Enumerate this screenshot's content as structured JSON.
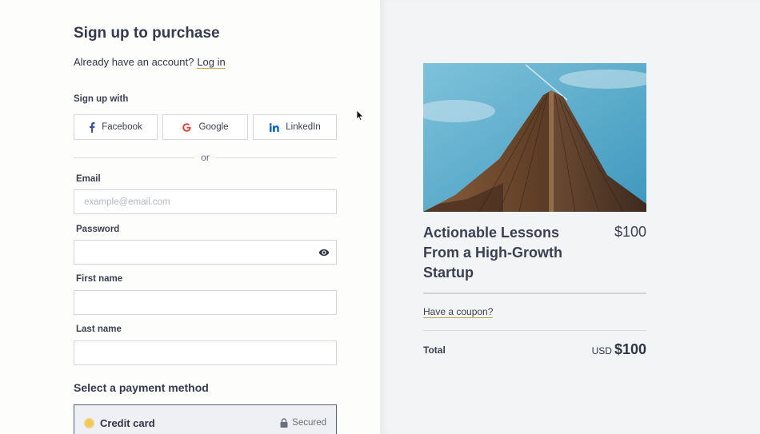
{
  "form": {
    "heading": "Sign up to purchase",
    "account_prompt": "Already have an account?",
    "login_link": "Log in",
    "signup_with": "Sign up with",
    "social": [
      {
        "label": "Facebook",
        "icon": "facebook-icon"
      },
      {
        "label": "Google",
        "icon": "google-icon"
      },
      {
        "label": "LinkedIn",
        "icon": "linkedin-icon"
      }
    ],
    "divider": "or",
    "email": {
      "label": "Email",
      "placeholder": "example@email.com",
      "value": ""
    },
    "password": {
      "label": "Password",
      "value": "",
      "icon": "eye-icon"
    },
    "first_name": {
      "label": "First name",
      "value": ""
    },
    "last_name": {
      "label": "Last name",
      "value": ""
    },
    "payment": {
      "heading": "Select a payment method",
      "selected": "Credit card",
      "secured": "Secured"
    }
  },
  "product": {
    "title": "Actionable Lessons From a High-Growth Startup",
    "price": "$100",
    "coupon_link": "Have a coupon?",
    "total_label": "Total",
    "total_currency": "USD",
    "total_amount": "$100",
    "image": "skyscraper-photo"
  },
  "colors": {
    "accent_underline": "#c6a94a",
    "radio_selected": "#f3c94a",
    "facebook": "#3b5998",
    "google": "#db4437",
    "linkedin": "#0a66c2"
  }
}
